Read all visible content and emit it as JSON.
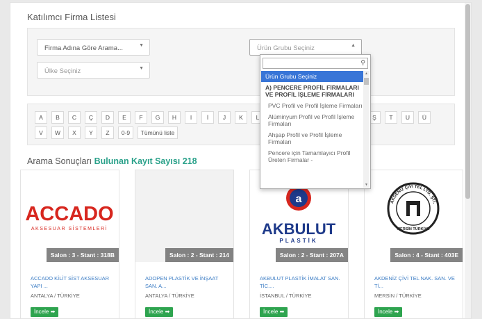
{
  "section_title": "Katılımcı Firma Listesi",
  "filters": {
    "firm_select": "Firma Adına Göre Arama...",
    "country_select": "Ülke Seçiniz",
    "product_group_select": "Ürün Grubu Seçiniz"
  },
  "dropdown": {
    "search_value": "",
    "items": [
      {
        "label": "Ürün Grubu Seçiniz",
        "kind": "selected"
      },
      {
        "label": "A) PENCERE PROFİL FİRMALARI VE PROFİL İŞLEME FİRMALARI",
        "kind": "group"
      },
      {
        "label": "PVC Profil ve Profil İşleme Firmaları",
        "kind": "option"
      },
      {
        "label": "Alüminyum Profil ve Profil İşleme Firmaları",
        "kind": "option"
      },
      {
        "label": "Ahşap Profil ve Profil İşleme Firmaları",
        "kind": "option"
      },
      {
        "label": "Pencere için Tamamlayıcı Profil Üreten Firmalar -",
        "kind": "option"
      }
    ]
  },
  "alphabet": {
    "row1": [
      "A",
      "B",
      "C",
      "Ç",
      "D",
      "E",
      "F",
      "G",
      "H",
      "I",
      "İ",
      "J",
      "K",
      "L",
      "",
      "",
      "",
      "",
      "",
      "S",
      "Ş",
      "T",
      "U",
      "Ü"
    ],
    "row2": [
      "V",
      "W",
      "X",
      "Y",
      "Z",
      "0-9",
      "Tümünü liste"
    ]
  },
  "results": {
    "label": "Arama Sonuçları",
    "count_text": "Bulunan Kayıt Sayısı 218"
  },
  "cards": [
    {
      "logo": "ACCADO",
      "logo_sub": "AKSESUAR SİSTEMLERİ",
      "badge": "Salon : 3 - Stant : 318B",
      "name": "ACCADO KİLİT SİST AKSESUAR YAPI ...",
      "location": "ANTALYA / TÜRKİYE",
      "button": "İncele ➡"
    },
    {
      "logo": "",
      "logo_sub": "",
      "badge": "Salon : 2 - Stant : 214",
      "name": "ADOPEN PLASTİK VE İNŞAAT SAN. A...",
      "location": "ANTALYA / TÜRKİYE",
      "button": "İncele ➡"
    },
    {
      "logo": "AKBULUT",
      "logo_sub": "PLASTİK",
      "badge": "Salon : 2 - Stant : 207A",
      "name": "AKBULUT PLASTİK İMALAT SAN. TİC....",
      "location": "İSTANBUL / TÜRKİYE",
      "button": "İncele ➡"
    },
    {
      "logo": "AKDENİZ ÇİVİ TEL LTD. ŞTİ.",
      "logo_sub": "MERSİN TÜRKİYE",
      "badge": "Salon : 4 - Stant : 403E",
      "name": "AKDENİZ ÇİVİ TEL NAK. SAN. VE Tİ...",
      "location": "MERSİN / TÜRKİYE",
      "button": "İncele ➡"
    }
  ],
  "colors": {
    "accent_green": "#2aa18a",
    "button_green": "#2ea44f",
    "link_blue": "#3b7cc4",
    "selected_blue": "#3875d7",
    "accado_red": "#d7261e",
    "akbulut_blue": "#1e3a8a"
  }
}
